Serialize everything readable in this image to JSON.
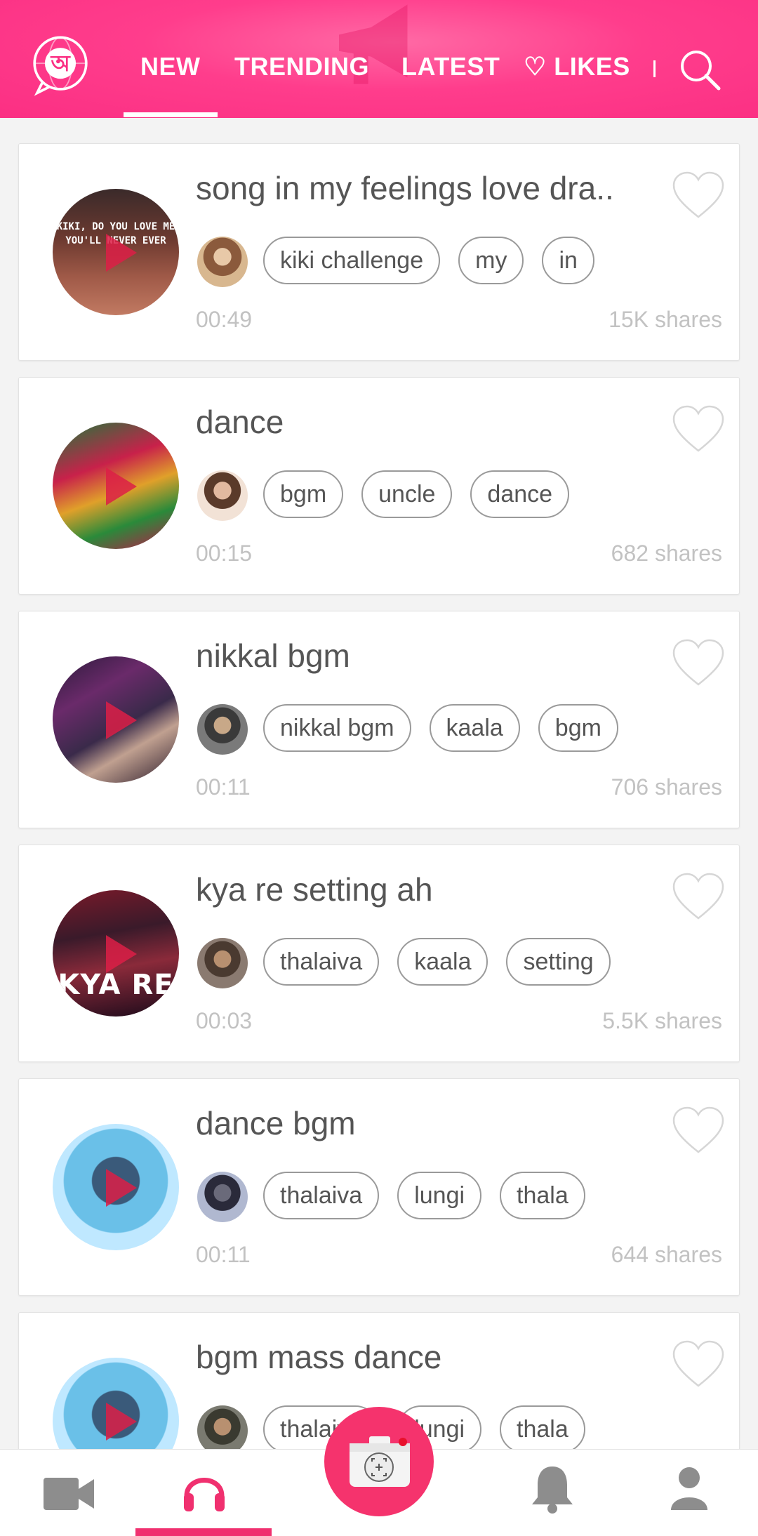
{
  "header": {
    "logo_letter": "অ",
    "tabs": [
      {
        "label": "NEW"
      },
      {
        "label": "TRENDING"
      },
      {
        "label": "LATEST"
      },
      {
        "label": "♡ LIKES"
      }
    ],
    "active_tab": "NEW",
    "accent_color": "#fb2f83"
  },
  "feed": [
    {
      "title": "song in my feelings love dra..",
      "thumb_caption": "KIKI, DO YOU LOVE ME YOU'LL NEVER EVER",
      "tags": [
        "kiki challenge",
        "my",
        "in"
      ],
      "duration": "00:49",
      "shares": "15K shares"
    },
    {
      "title": "dance",
      "tags": [
        "bgm",
        "uncle",
        "dance"
      ],
      "duration": "00:15",
      "shares": "682 shares"
    },
    {
      "title": "nikkal bgm",
      "tags": [
        "nikkal bgm",
        "kaala",
        "bgm"
      ],
      "duration": "00:11",
      "shares": "706 shares"
    },
    {
      "title": "kya re setting ah",
      "thumb_caption": "KYA RE",
      "tags": [
        "thalaiva",
        "kaala",
        "setting"
      ],
      "duration": "00:03",
      "shares": "5.5K shares"
    },
    {
      "title": "dance bgm",
      "tags": [
        "thalaiva",
        "lungi",
        "thala"
      ],
      "duration": "00:11",
      "shares": "644 shares"
    },
    {
      "title": "bgm mass dance",
      "tags": [
        "thalaiva",
        "lungi",
        "thala"
      ]
    }
  ],
  "bottom_nav": {
    "items": [
      "video-camera-icon",
      "headphones-icon",
      "camera-icon",
      "bell-icon",
      "person-icon"
    ],
    "active": "headphones-icon",
    "active_color": "#f0306f"
  }
}
